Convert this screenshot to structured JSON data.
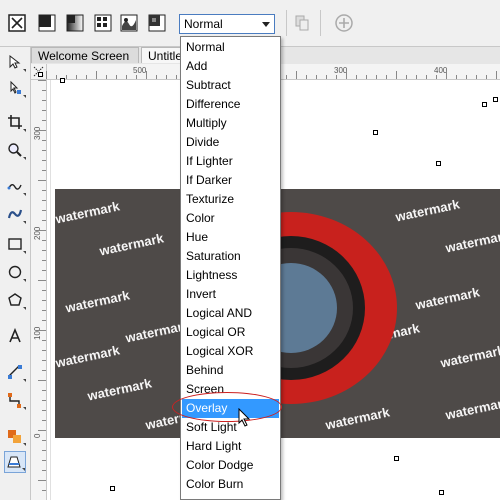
{
  "toolbar": {
    "tools": [
      "transparency-none-icon",
      "transparency-uniform-icon",
      "transparency-fountain-icon",
      "transparency-pattern-icon",
      "transparency-texture-icon"
    ],
    "merge_mode_value": "Normal",
    "copy_icon": "copy-transparency-icon",
    "add_icon": "plus-circle-icon"
  },
  "toolbox": {
    "tools": [
      "pick-tool-icon",
      "shape-tool-icon",
      "crop-tool-icon",
      "zoom-tool-icon",
      "freehand-tool-icon",
      "artistic-media-tool-icon",
      "rectangle-tool-icon",
      "ellipse-tool-icon",
      "polygon-tool-icon",
      "text-tool-icon",
      "dimension-tool-icon",
      "connector-tool-icon",
      "interactive-fill-icon",
      "transparency-tool-icon"
    ]
  },
  "tabs": [
    {
      "label": "Welcome Screen"
    },
    {
      "label": "Untitle"
    }
  ],
  "rulers": {
    "horizontal_labels": [
      "500",
      "300",
      "400"
    ],
    "vertical_labels": [
      "300",
      "200",
      "100",
      "0"
    ]
  },
  "artwork": {
    "watermark_text": "watermark",
    "background_color": "#4e4a48",
    "ring_color": "#c8211d",
    "inner_ring_color": "#1e1d1d",
    "center_color": "#5d7a95"
  },
  "merge_mode_dropdown": {
    "items": [
      "Normal",
      "Add",
      "Subtract",
      "Difference",
      "Multiply",
      "Divide",
      "If Lighter",
      "If Darker",
      "Texturize",
      "Color",
      "Hue",
      "Saturation",
      "Lightness",
      "Invert",
      "Logical AND",
      "Logical OR",
      "Logical XOR",
      "Behind",
      "Screen",
      "Overlay",
      "Soft Light",
      "Hard Light",
      "Color Dodge",
      "Color Burn"
    ],
    "selected": "Overlay",
    "highlight_color": "#3399ff"
  }
}
